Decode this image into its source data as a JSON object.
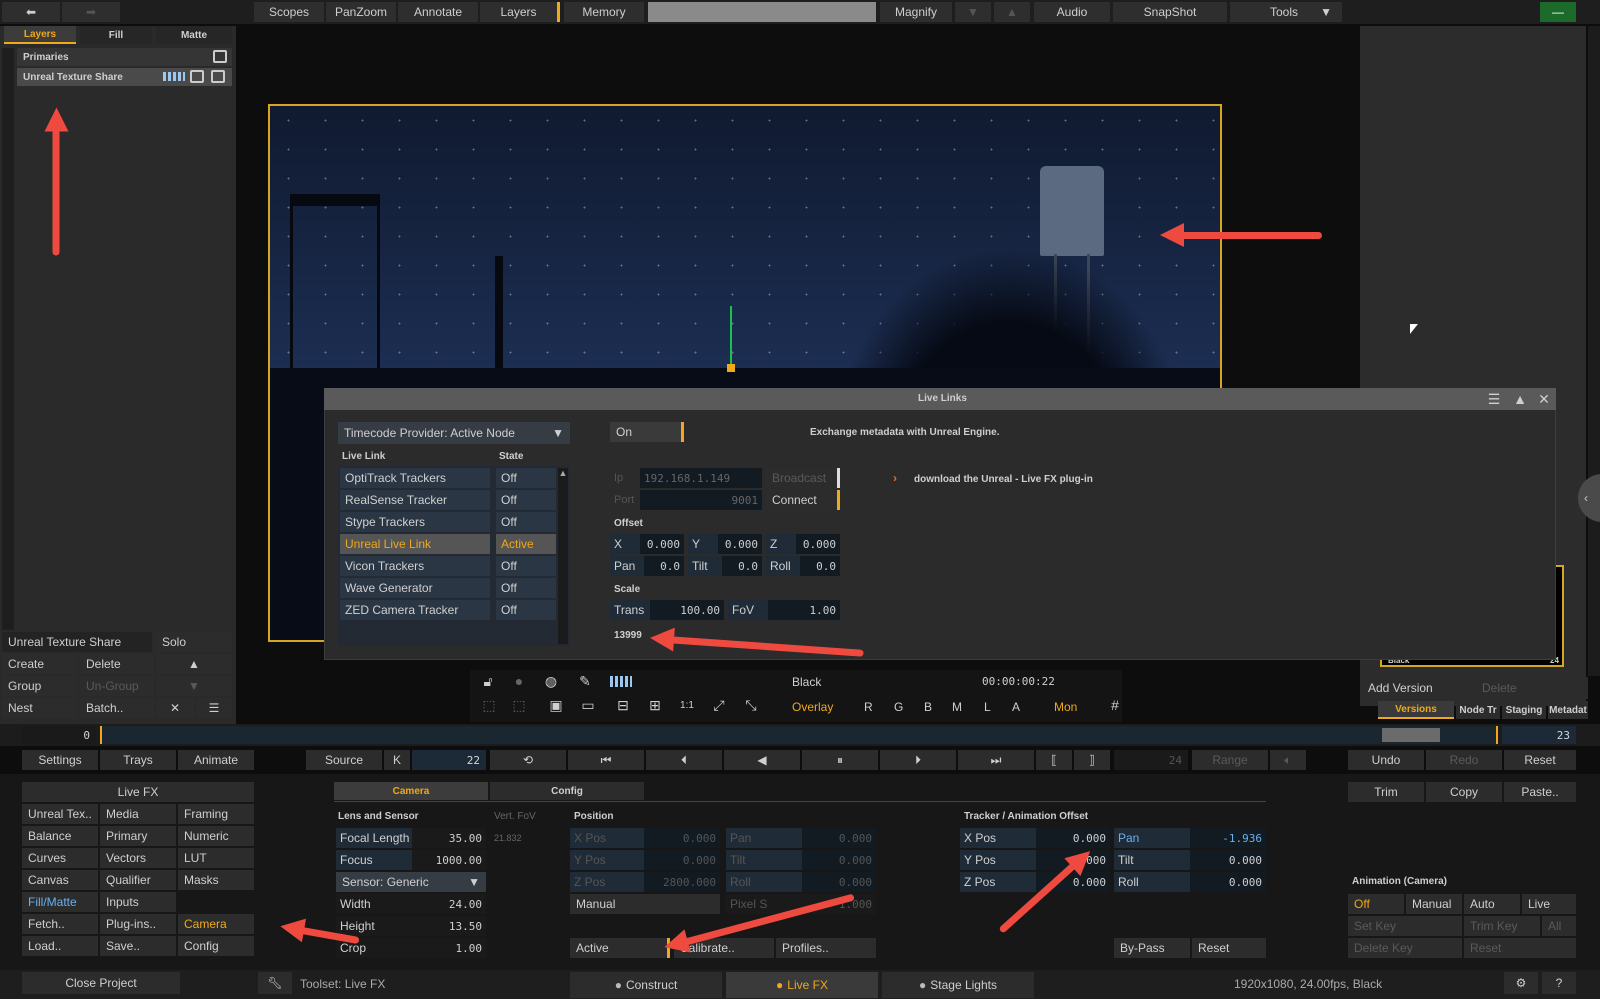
{
  "top": {
    "scopes": "Scopes",
    "panzoom": "PanZoom",
    "annotate": "Annotate",
    "layers": "Layers",
    "memory": "Memory",
    "magnify": "Magnify",
    "audio": "Audio",
    "snapshot": "SnapShot",
    "tools": "Tools"
  },
  "left": {
    "tabs": [
      "Layers",
      "Fill",
      "Matte"
    ],
    "primaries": "Primaries",
    "layer_item": "Unreal Texture Share",
    "bottom_name": "Unreal Texture Share",
    "solo": "Solo",
    "create": "Create",
    "delete": "Delete",
    "group": "Group",
    "ungroup": "Un-Group",
    "nest": "Nest",
    "batch": "Batch.."
  },
  "dialog": {
    "title": "Live Links",
    "timecode": "Timecode Provider: Active Node",
    "col_link": "Live Link",
    "col_state": "State",
    "links": [
      {
        "name": "OptiTrack Trackers",
        "state": "Off"
      },
      {
        "name": "RealSense Tracker",
        "state": "Off"
      },
      {
        "name": "Stype Trackers",
        "state": "Off"
      },
      {
        "name": "Unreal Live Link",
        "state": "Active"
      },
      {
        "name": "Vicon Trackers",
        "state": "Off"
      },
      {
        "name": "Wave Generator",
        "state": "Off"
      },
      {
        "name": "ZED Camera Tracker",
        "state": "Off"
      }
    ],
    "on": "On",
    "exchange": "Exchange metadata with Unreal Engine.",
    "ip_label": "Ip",
    "ip": "192.168.1.149",
    "broadcast": "Broadcast",
    "port_label": "Port",
    "port": "9001",
    "connect": "Connect",
    "download": "download the Unreal - Live FX plug-in",
    "offset": "Offset",
    "x_l": "X",
    "x": "0.000",
    "y_l": "Y",
    "y": "0.000",
    "z_l": "Z",
    "z": "0.000",
    "pan_l": "Pan",
    "pan": "0.0",
    "tilt_l": "Tilt",
    "tilt": "0.0",
    "roll_l": "Roll",
    "roll": "0.0",
    "scale": "Scale",
    "trans_l": "Trans",
    "trans": "100.00",
    "fov_l": "FoV",
    "fov": "1.00",
    "frame": "13999"
  },
  "viewer": {
    "clip": "Black",
    "timecode": "00:00:00:22",
    "overlay": "Overlay",
    "channels": [
      "R",
      "G",
      "B",
      "M",
      "L",
      "A"
    ],
    "mon": "Mon"
  },
  "right": {
    "add_version": "Add Version",
    "delete": "Delete",
    "tabs": [
      "Versions",
      "Node Tr",
      "Staging",
      "Metadat"
    ],
    "thumb_label": "Black",
    "thumb_num": "24"
  },
  "timeline": {
    "start": "0",
    "end": "23"
  },
  "transport": {
    "settings": "Settings",
    "trays": "Trays",
    "animate": "Animate",
    "source": "Source",
    "k": "K",
    "frame": "22",
    "total": "24",
    "range": "Range",
    "undo": "Undo",
    "redo": "Redo",
    "reset": "Reset"
  },
  "livefx": {
    "title": "Live FX",
    "grid": [
      [
        "Unreal Tex..",
        "Media",
        "Framing"
      ],
      [
        "Balance",
        "Primary",
        "Numeric"
      ],
      [
        "Curves",
        "Vectors",
        "LUT"
      ],
      [
        "Canvas",
        "Qualifier",
        "Masks"
      ],
      [
        "Fill/Matte",
        "Inputs",
        ""
      ],
      [
        "Fetch..",
        "Plug-ins..",
        "Camera"
      ],
      [
        "Load..",
        "Save..",
        "Config"
      ]
    ]
  },
  "camera": {
    "tab_camera": "Camera",
    "tab_config": "Config",
    "lens": "Lens and Sensor",
    "vert_fov": "Vert. FoV",
    "vert_fov_val": "21.832",
    "focal_l": "Focal Length",
    "focal": "35.00",
    "focus_l": "Focus",
    "focus": "1000.00",
    "sensor": "Sensor: Generic",
    "width_l": "Width",
    "width": "24.00",
    "height_l": "Height",
    "height": "13.50",
    "crop_l": "Crop",
    "crop": "1.00",
    "position": "Position",
    "xpos_l": "X Pos",
    "xpos": "0.000",
    "ypos_l": "Y Pos",
    "ypos": "0.000",
    "zpos_l": "Z Pos",
    "zpos": "2800.000",
    "pan_l": "Pan",
    "pan": "0.000",
    "tilt_l": "Tilt",
    "tilt": "0.000",
    "roll_l": "Roll",
    "roll": "0.000",
    "manual": "Manual",
    "pixel_l": "Pixel S",
    "pixel": "1.000",
    "active": "Active",
    "calibrate": "Calibrate..",
    "profiles": "Profiles..",
    "tracker": "Tracker / Animation Offset",
    "txpos_l": "X Pos",
    "txpos": "0.000",
    "typos_l": "Y Pos",
    "typos": "0.000",
    "tzpos_l": "Z Pos",
    "tzpos": "0.000",
    "tpan_l": "Pan",
    "tpan": "-1.936",
    "ttilt_l": "Tilt",
    "ttilt": "0.000",
    "troll_l": "Roll",
    "troll": "0.000",
    "bypass": "By-Pass",
    "treset": "Reset"
  },
  "anim": {
    "trim": "Trim",
    "copy": "Copy",
    "paste": "Paste..",
    "title": "Animation (Camera)",
    "off": "Off",
    "manual": "Manual",
    "auto": "Auto",
    "live": "Live",
    "setkey": "Set Key",
    "trimkey": "Trim Key",
    "all": "All",
    "delkey": "Delete Key",
    "reset": "Reset"
  },
  "status": {
    "close": "Close Project",
    "toolset": "Toolset: Live FX",
    "construct": "Construct",
    "livefx": "Live FX",
    "stage": "Stage Lights",
    "info": "1920x1080, 24.00fps, Black"
  }
}
